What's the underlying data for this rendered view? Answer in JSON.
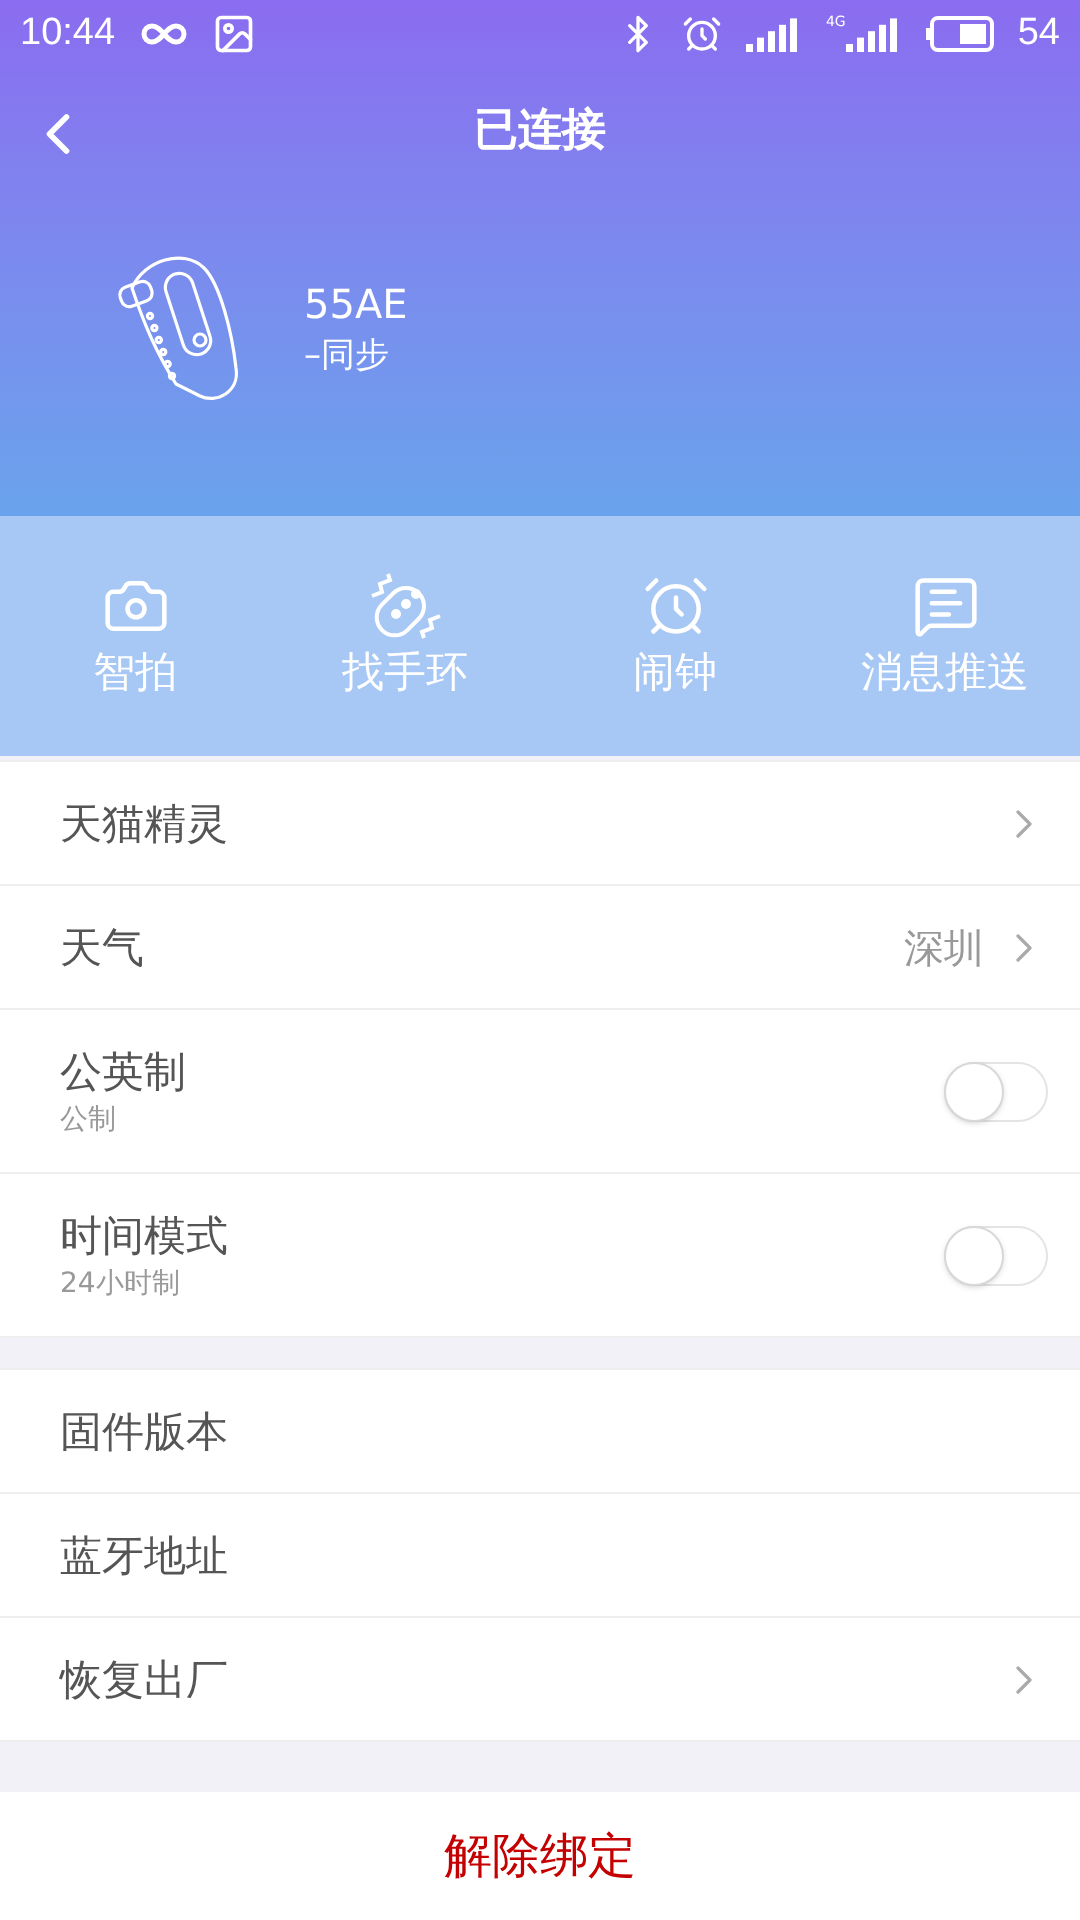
{
  "status_bar": {
    "time": "10:44",
    "network_label": "4G",
    "battery": "54"
  },
  "header": {
    "title": "已连接"
  },
  "device": {
    "name": "55AE",
    "sync": "–同步"
  },
  "actions": [
    {
      "kind": "camera",
      "label": "智拍"
    },
    {
      "kind": "find",
      "label": "找手环"
    },
    {
      "kind": "alarm",
      "label": "闹钟"
    },
    {
      "kind": "message",
      "label": "消息推送"
    }
  ],
  "groups": [
    {
      "rows": [
        {
          "kind": "link",
          "label": "天猫精灵"
        },
        {
          "kind": "link",
          "label": "天气",
          "value": "深圳"
        },
        {
          "kind": "toggle",
          "label": "公英制",
          "subtitle": "公制",
          "on": false
        },
        {
          "kind": "toggle",
          "label": "时间模式",
          "subtitle": "24小时制",
          "on": false
        }
      ]
    },
    {
      "rows": [
        {
          "kind": "plain",
          "label": "固件版本"
        },
        {
          "kind": "plain",
          "label": "蓝牙地址"
        },
        {
          "kind": "link",
          "label": "恢复出厂"
        }
      ]
    }
  ],
  "unbind_button": "解除绑定"
}
